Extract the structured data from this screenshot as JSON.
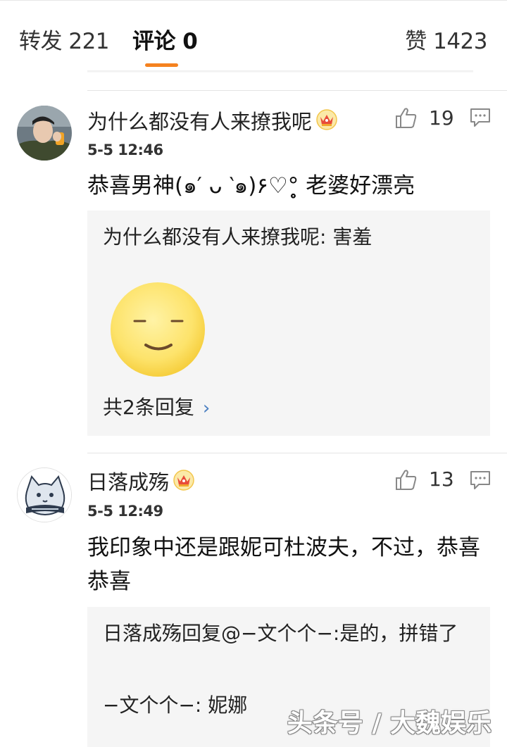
{
  "tabs": {
    "reposts": "转发 221",
    "comments": "评论 0",
    "likes": "赞 1423"
  },
  "comments": [
    {
      "username": "为什么都没有人来撩我呢",
      "time": "5-5 12:46",
      "likes": "19",
      "text": "恭喜男神(๑′ ᴗ ‵๑)۶♡°̥̥̥̥̥̥̥̥ 老婆好漂亮",
      "replies": [
        {
          "text": "为什么都没有人来撩我呢: 害羞",
          "sticker": "shy-face-sticker"
        }
      ],
      "more_replies": "共2条回复"
    },
    {
      "username": "日落成殇",
      "time": "5-5 12:49",
      "likes": "13",
      "text": "我印象中还是跟妮可杜波夫，不过，恭喜恭喜",
      "replies": [
        {
          "text": "日落成殇回复@−文个个−:是的，拼错了"
        },
        {
          "text": "−文个个−: 妮娜"
        }
      ]
    }
  ],
  "watermark": "头条号 / 大魏娱乐",
  "icons": {
    "like": "thumbs-up-icon",
    "reply": "comment-bubble-icon",
    "crown": "vip-crown-icon"
  },
  "colors": {
    "accent": "#f5821f",
    "link": "#4a7fc1",
    "reply_bg": "#f5f5f5"
  }
}
